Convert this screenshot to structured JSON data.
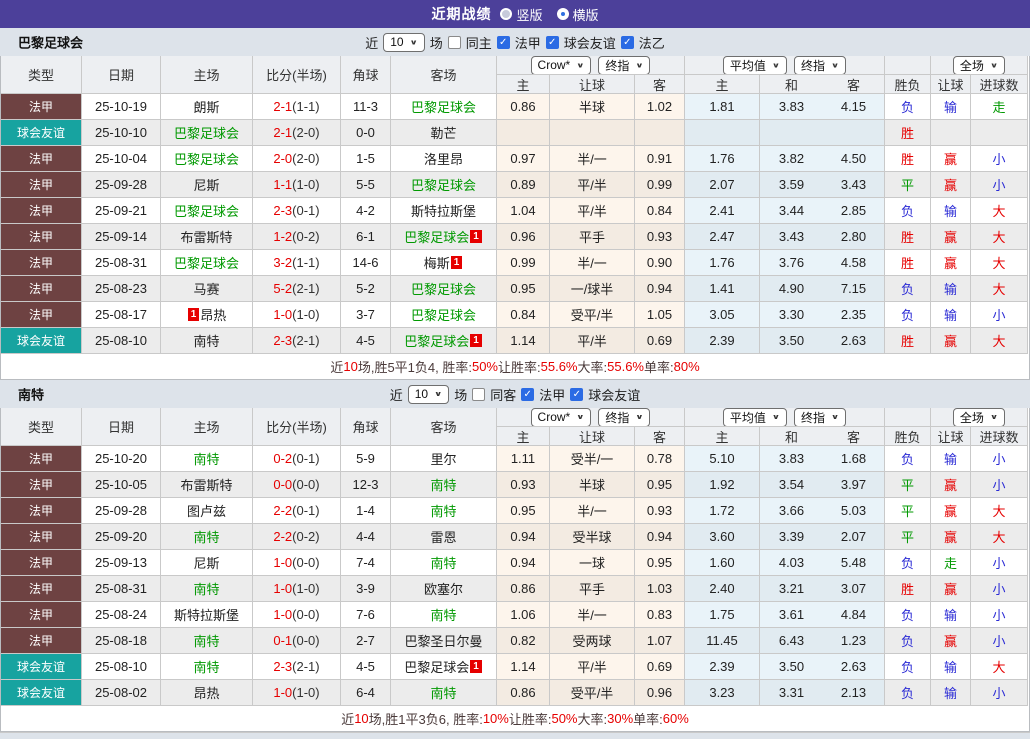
{
  "topbar": {
    "title": "近期战绩",
    "radios": [
      {
        "label": "竖版",
        "checked": false
      },
      {
        "label": "横版",
        "checked": true
      }
    ]
  },
  "colors": {
    "header_purple": "#4c409a",
    "teambar_bg": "#dde3ea",
    "type_league_bg": "#6e4242",
    "type_friendly_bg": "#17a3a0",
    "focus_team_green": "#009900",
    "score_red": "#e60000",
    "win_red": "#e60000",
    "draw_green": "#009900",
    "lose_blue": "#2b2bd5",
    "checkbox_blue": "#2b6be4"
  },
  "result_color_map": {
    "胜": "r",
    "赢": "r",
    "大": "r",
    "平": "g",
    "走": "g",
    "负": "b",
    "输": "b",
    "小": "b"
  },
  "type_colors": {
    "法甲": "#6e4242",
    "球会友谊": "#17a3a0"
  },
  "columns": [
    "类型",
    "日期",
    "主场",
    "比分(半场)",
    "角球",
    "客场",
    "主",
    "让球",
    "客",
    "主",
    "和",
    "客",
    "胜负",
    "让球",
    "进球数"
  ],
  "column_names": [
    "col-type",
    "col-date",
    "col-home",
    "col-score",
    "col-corner",
    "col-away",
    "col-odds-home",
    "col-odds-handicap",
    "col-odds-away",
    "col-avg-home",
    "col-avg-draw",
    "col-avg-away",
    "col-result",
    "col-handicap-result",
    "col-goals-result"
  ],
  "tables": [
    {
      "team": "巴黎足球会",
      "filter": {
        "near_label": "近",
        "count": "10",
        "unit_label": "场",
        "checkboxes": [
          {
            "label": "同主",
            "checked": false,
            "name": "same-home-checkbox"
          },
          {
            "label": "法甲",
            "checked": true,
            "name": "ligue1-checkbox"
          },
          {
            "label": "球会友谊",
            "checked": true,
            "name": "club-friendly-checkbox"
          },
          {
            "label": "法乙",
            "checked": true,
            "name": "ligue2-checkbox"
          }
        ]
      },
      "selects": {
        "odds": "Crow*",
        "odds_final": "终指",
        "avg": "平均值",
        "avg_final": "终指",
        "scope": "全场"
      },
      "rows": [
        {
          "type": "法甲",
          "date": "25-10-19",
          "home": {
            "n": "朗斯",
            "f": false,
            "b": null,
            "bp": "r"
          },
          "score": "2-1",
          "half": "(1-1)",
          "corner": "11-3",
          "away": {
            "n": "巴黎足球会",
            "f": true,
            "b": null,
            "bp": "r"
          },
          "odds": [
            "0.86",
            "半球",
            "1.02"
          ],
          "avg": [
            "1.81",
            "3.83",
            "4.15"
          ],
          "result": [
            "负",
            "输",
            "走"
          ]
        },
        {
          "type": "球会友谊",
          "date": "25-10-10",
          "home": {
            "n": "巴黎足球会",
            "f": true,
            "b": null,
            "bp": "r"
          },
          "score": "2-1",
          "half": "(2-0)",
          "corner": "0-0",
          "away": {
            "n": "勒芒",
            "f": false,
            "b": null,
            "bp": "r"
          },
          "odds": [
            "",
            "",
            ""
          ],
          "avg": [
            "",
            "",
            ""
          ],
          "result": [
            "胜",
            "",
            ""
          ]
        },
        {
          "type": "法甲",
          "date": "25-10-04",
          "home": {
            "n": "巴黎足球会",
            "f": true,
            "b": null,
            "bp": "r"
          },
          "score": "2-0",
          "half": "(2-0)",
          "corner": "1-5",
          "away": {
            "n": "洛里昂",
            "f": false,
            "b": null,
            "bp": "r"
          },
          "odds": [
            "0.97",
            "半/一",
            "0.91"
          ],
          "avg": [
            "1.76",
            "3.82",
            "4.50"
          ],
          "result": [
            "胜",
            "赢",
            "小"
          ]
        },
        {
          "type": "法甲",
          "date": "25-09-28",
          "home": {
            "n": "尼斯",
            "f": false,
            "b": null,
            "bp": "r"
          },
          "score": "1-1",
          "half": "(1-0)",
          "corner": "5-5",
          "away": {
            "n": "巴黎足球会",
            "f": true,
            "b": null,
            "bp": "r"
          },
          "odds": [
            "0.89",
            "平/半",
            "0.99"
          ],
          "avg": [
            "2.07",
            "3.59",
            "3.43"
          ],
          "result": [
            "平",
            "赢",
            "小"
          ]
        },
        {
          "type": "法甲",
          "date": "25-09-21",
          "home": {
            "n": "巴黎足球会",
            "f": true,
            "b": null,
            "bp": "r"
          },
          "score": "2-3",
          "half": "(0-1)",
          "corner": "4-2",
          "away": {
            "n": "斯特拉斯堡",
            "f": false,
            "b": null,
            "bp": "r"
          },
          "odds": [
            "1.04",
            "平/半",
            "0.84"
          ],
          "avg": [
            "2.41",
            "3.44",
            "2.85"
          ],
          "result": [
            "负",
            "输",
            "大"
          ]
        },
        {
          "type": "法甲",
          "date": "25-09-14",
          "home": {
            "n": "布雷斯特",
            "f": false,
            "b": null,
            "bp": "r"
          },
          "score": "1-2",
          "half": "(0-2)",
          "corner": "6-1",
          "away": {
            "n": "巴黎足球会",
            "f": true,
            "b": "1",
            "bp": "r"
          },
          "odds": [
            "0.96",
            "平手",
            "0.93"
          ],
          "avg": [
            "2.47",
            "3.43",
            "2.80"
          ],
          "result": [
            "胜",
            "赢",
            "大"
          ]
        },
        {
          "type": "法甲",
          "date": "25-08-31",
          "home": {
            "n": "巴黎足球会",
            "f": true,
            "b": null,
            "bp": "r"
          },
          "score": "3-2",
          "half": "(1-1)",
          "corner": "14-6",
          "away": {
            "n": "梅斯",
            "f": false,
            "b": "1",
            "bp": "r"
          },
          "odds": [
            "0.99",
            "半/一",
            "0.90"
          ],
          "avg": [
            "1.76",
            "3.76",
            "4.58"
          ],
          "result": [
            "胜",
            "赢",
            "大"
          ]
        },
        {
          "type": "法甲",
          "date": "25-08-23",
          "home": {
            "n": "马赛",
            "f": false,
            "b": null,
            "bp": "r"
          },
          "score": "5-2",
          "half": "(2-1)",
          "corner": "5-2",
          "away": {
            "n": "巴黎足球会",
            "f": true,
            "b": null,
            "bp": "r"
          },
          "odds": [
            "0.95",
            "一/球半",
            "0.94"
          ],
          "avg": [
            "1.41",
            "4.90",
            "7.15"
          ],
          "result": [
            "负",
            "输",
            "大"
          ]
        },
        {
          "type": "法甲",
          "date": "25-08-17",
          "home": {
            "n": "昂热",
            "f": false,
            "b": "1",
            "bp": "l"
          },
          "score": "1-0",
          "half": "(1-0)",
          "corner": "3-7",
          "away": {
            "n": "巴黎足球会",
            "f": true,
            "b": null,
            "bp": "r"
          },
          "odds": [
            "0.84",
            "受平/半",
            "1.05"
          ],
          "avg": [
            "3.05",
            "3.30",
            "2.35"
          ],
          "result": [
            "负",
            "输",
            "小"
          ]
        },
        {
          "type": "球会友谊",
          "date": "25-08-10",
          "home": {
            "n": "南特",
            "f": false,
            "b": null,
            "bp": "r"
          },
          "score": "2-3",
          "half": "(2-1)",
          "corner": "4-5",
          "away": {
            "n": "巴黎足球会",
            "f": true,
            "b": "1",
            "bp": "r"
          },
          "odds": [
            "1.14",
            "平/半",
            "0.69"
          ],
          "avg": [
            "2.39",
            "3.50",
            "2.63"
          ],
          "result": [
            "胜",
            "赢",
            "大"
          ]
        }
      ],
      "summary": [
        {
          "t": "近",
          "red": false
        },
        {
          "t": "10",
          "red": true
        },
        {
          "t": "场,胜5平1负4, 胜率:",
          "red": false
        },
        {
          "t": "50%",
          "red": true
        },
        {
          "t": " 让胜率:",
          "red": false
        },
        {
          "t": "55.6%",
          "red": true
        },
        {
          "t": " 大率:",
          "red": false
        },
        {
          "t": "55.6%",
          "red": true
        },
        {
          "t": " 单率:",
          "red": false
        },
        {
          "t": "80%",
          "red": true
        }
      ]
    },
    {
      "team": "南特",
      "filter": {
        "near_label": "近",
        "count": "10",
        "unit_label": "场",
        "checkboxes": [
          {
            "label": "同客",
            "checked": false,
            "name": "same-away-checkbox"
          },
          {
            "label": "法甲",
            "checked": true,
            "name": "ligue1-checkbox"
          },
          {
            "label": "球会友谊",
            "checked": true,
            "name": "club-friendly-checkbox"
          }
        ]
      },
      "selects": {
        "odds": "Crow*",
        "odds_final": "终指",
        "avg": "平均值",
        "avg_final": "终指",
        "scope": "全场"
      },
      "rows": [
        {
          "type": "法甲",
          "date": "25-10-20",
          "home": {
            "n": "南特",
            "f": true,
            "b": null,
            "bp": "r"
          },
          "score": "0-2",
          "half": "(0-1)",
          "corner": "5-9",
          "away": {
            "n": "里尔",
            "f": false,
            "b": null,
            "bp": "r"
          },
          "odds": [
            "1.11",
            "受半/一",
            "0.78"
          ],
          "avg": [
            "5.10",
            "3.83",
            "1.68"
          ],
          "result": [
            "负",
            "输",
            "小"
          ]
        },
        {
          "type": "法甲",
          "date": "25-10-05",
          "home": {
            "n": "布雷斯特",
            "f": false,
            "b": null,
            "bp": "r"
          },
          "score": "0-0",
          "half": "(0-0)",
          "corner": "12-3",
          "away": {
            "n": "南特",
            "f": true,
            "b": null,
            "bp": "r"
          },
          "odds": [
            "0.93",
            "半球",
            "0.95"
          ],
          "avg": [
            "1.92",
            "3.54",
            "3.97"
          ],
          "result": [
            "平",
            "赢",
            "小"
          ]
        },
        {
          "type": "法甲",
          "date": "25-09-28",
          "home": {
            "n": "图卢兹",
            "f": false,
            "b": null,
            "bp": "r"
          },
          "score": "2-2",
          "half": "(0-1)",
          "corner": "1-4",
          "away": {
            "n": "南特",
            "f": true,
            "b": null,
            "bp": "r"
          },
          "odds": [
            "0.95",
            "半/一",
            "0.93"
          ],
          "avg": [
            "1.72",
            "3.66",
            "5.03"
          ],
          "result": [
            "平",
            "赢",
            "大"
          ]
        },
        {
          "type": "法甲",
          "date": "25-09-20",
          "home": {
            "n": "南特",
            "f": true,
            "b": null,
            "bp": "r"
          },
          "score": "2-2",
          "half": "(0-2)",
          "corner": "4-4",
          "away": {
            "n": "雷恩",
            "f": false,
            "b": null,
            "bp": "r"
          },
          "odds": [
            "0.94",
            "受半球",
            "0.94"
          ],
          "avg": [
            "3.60",
            "3.39",
            "2.07"
          ],
          "result": [
            "平",
            "赢",
            "大"
          ]
        },
        {
          "type": "法甲",
          "date": "25-09-13",
          "home": {
            "n": "尼斯",
            "f": false,
            "b": null,
            "bp": "r"
          },
          "score": "1-0",
          "half": "(0-0)",
          "corner": "7-4",
          "away": {
            "n": "南特",
            "f": true,
            "b": null,
            "bp": "r"
          },
          "odds": [
            "0.94",
            "一球",
            "0.95"
          ],
          "avg": [
            "1.60",
            "4.03",
            "5.48"
          ],
          "result": [
            "负",
            "走",
            "小"
          ]
        },
        {
          "type": "法甲",
          "date": "25-08-31",
          "home": {
            "n": "南特",
            "f": true,
            "b": null,
            "bp": "r"
          },
          "score": "1-0",
          "half": "(1-0)",
          "corner": "3-9",
          "away": {
            "n": "欧塞尔",
            "f": false,
            "b": null,
            "bp": "r"
          },
          "odds": [
            "0.86",
            "平手",
            "1.03"
          ],
          "avg": [
            "2.40",
            "3.21",
            "3.07"
          ],
          "result": [
            "胜",
            "赢",
            "小"
          ]
        },
        {
          "type": "法甲",
          "date": "25-08-24",
          "home": {
            "n": "斯特拉斯堡",
            "f": false,
            "b": null,
            "bp": "r"
          },
          "score": "1-0",
          "half": "(0-0)",
          "corner": "7-6",
          "away": {
            "n": "南特",
            "f": true,
            "b": null,
            "bp": "r"
          },
          "odds": [
            "1.06",
            "半/一",
            "0.83"
          ],
          "avg": [
            "1.75",
            "3.61",
            "4.84"
          ],
          "result": [
            "负",
            "输",
            "小"
          ]
        },
        {
          "type": "法甲",
          "date": "25-08-18",
          "home": {
            "n": "南特",
            "f": true,
            "b": null,
            "bp": "r"
          },
          "score": "0-1",
          "half": "(0-0)",
          "corner": "2-7",
          "away": {
            "n": "巴黎圣日尔曼",
            "f": false,
            "b": null,
            "bp": "r"
          },
          "odds": [
            "0.82",
            "受两球",
            "1.07"
          ],
          "avg": [
            "11.45",
            "6.43",
            "1.23"
          ],
          "result": [
            "负",
            "赢",
            "小"
          ]
        },
        {
          "type": "球会友谊",
          "date": "25-08-10",
          "home": {
            "n": "南特",
            "f": true,
            "b": null,
            "bp": "r"
          },
          "score": "2-3",
          "half": "(2-1)",
          "corner": "4-5",
          "away": {
            "n": "巴黎足球会",
            "f": false,
            "b": "1",
            "bp": "r"
          },
          "odds": [
            "1.14",
            "平/半",
            "0.69"
          ],
          "avg": [
            "2.39",
            "3.50",
            "2.63"
          ],
          "result": [
            "负",
            "输",
            "大"
          ]
        },
        {
          "type": "球会友谊",
          "date": "25-08-02",
          "home": {
            "n": "昂热",
            "f": false,
            "b": null,
            "bp": "r"
          },
          "score": "1-0",
          "half": "(1-0)",
          "corner": "6-4",
          "away": {
            "n": "南特",
            "f": true,
            "b": null,
            "bp": "r"
          },
          "odds": [
            "0.86",
            "受平/半",
            "0.96"
          ],
          "avg": [
            "3.23",
            "3.31",
            "2.13"
          ],
          "result": [
            "负",
            "输",
            "小"
          ]
        }
      ],
      "summary": [
        {
          "t": "近",
          "red": false
        },
        {
          "t": "10",
          "red": true
        },
        {
          "t": "场,胜1平3负6, 胜率:",
          "red": false
        },
        {
          "t": "10%",
          "red": true
        },
        {
          "t": " 让胜率:",
          "red": false
        },
        {
          "t": "50%",
          "red": true
        },
        {
          "t": " 大率:",
          "red": false
        },
        {
          "t": "30%",
          "red": true
        },
        {
          "t": " 单率:",
          "red": false
        },
        {
          "t": "60%",
          "red": true
        }
      ]
    }
  ]
}
